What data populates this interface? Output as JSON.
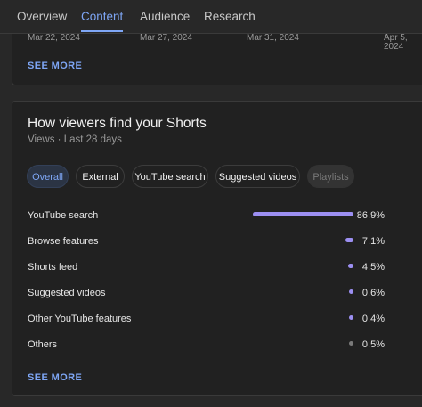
{
  "tabs": [
    {
      "label": "Overview",
      "active": false
    },
    {
      "label": "Content",
      "active": true
    },
    {
      "label": "Audience",
      "active": false
    },
    {
      "label": "Research",
      "active": false
    }
  ],
  "top_card": {
    "dates": [
      "Mar 22, 2024",
      "Mar 27, 2024",
      "Mar 31, 2024",
      "Apr 5, 2024"
    ],
    "see_more": "SEE MORE"
  },
  "shorts_card": {
    "title": "How viewers find your Shorts",
    "subtitle": "Views · Last 28 days",
    "filters": [
      {
        "label": "Overall",
        "state": "active"
      },
      {
        "label": "External",
        "state": "normal"
      },
      {
        "label": "YouTube search",
        "state": "normal"
      },
      {
        "label": "Suggested videos",
        "state": "normal"
      },
      {
        "label": "Playlists",
        "state": "disabled"
      }
    ],
    "rows": [
      {
        "label": "YouTube search",
        "percent": "86.9%",
        "value": 86.9
      },
      {
        "label": "Browse features",
        "percent": "7.1%",
        "value": 7.1
      },
      {
        "label": "Shorts feed",
        "percent": "4.5%",
        "value": 4.5
      },
      {
        "label": "Suggested videos",
        "percent": "0.6%",
        "value": 0.6
      },
      {
        "label": "Other YouTube features",
        "percent": "0.4%",
        "value": 0.4
      },
      {
        "label": "Others",
        "percent": "0.5%",
        "value": 0.5
      }
    ],
    "see_more": "SEE MORE"
  },
  "colors": {
    "accent": "#7ea6f5",
    "bar": "#9c8ff2",
    "bar_muted": "#7a7a7a"
  }
}
